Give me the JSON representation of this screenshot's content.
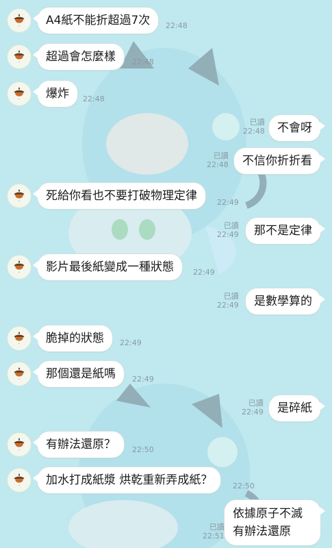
{
  "messages": [
    {
      "side": "left",
      "text": "A4紙不能折超過7次",
      "time": "22:48"
    },
    {
      "side": "left",
      "text": "超過會怎麼樣",
      "time": "22:48"
    },
    {
      "side": "left",
      "text": "爆炸",
      "time": "22:48"
    },
    {
      "side": "right",
      "text": "不會呀",
      "time": "22:48",
      "read": "已讀"
    },
    {
      "side": "right",
      "text": "不信你折折看",
      "time": "22:48",
      "read": "已讀"
    },
    {
      "side": "left",
      "text": "死給你看也不要打破物理定律",
      "time": "22:49"
    },
    {
      "side": "right",
      "text": "那不是定律",
      "time": "22:49",
      "read": "已讀"
    },
    {
      "side": "left",
      "text": "影片最後紙變成一種狀態",
      "time": "22:49"
    },
    {
      "side": "right",
      "text": "是數學算的",
      "time": "22:49",
      "read": "已讀"
    },
    {
      "side": "left",
      "text": "脆掉的狀態",
      "time": "22:49"
    },
    {
      "side": "left",
      "text": "那個還是紙嗎",
      "time": "22:49"
    },
    {
      "side": "right",
      "text": "是碎紙",
      "time": "22:49",
      "read": "已讀"
    },
    {
      "side": "left",
      "text": "有辦法還原？",
      "time": "22:50"
    },
    {
      "side": "left",
      "text": "加水打成紙漿 烘乾重新弄成紙？",
      "time": "22:50"
    },
    {
      "side": "right",
      "text": "依據原子不滅 有辦法還原",
      "time": "22:51",
      "read": "已讀"
    }
  ],
  "avatar_icon": "acorn-icon",
  "colors": {
    "background": "#bfe8ef",
    "bubble": "#ffffff",
    "meta": "#8a9aa0",
    "acorn_cap": "#6b3d1f",
    "acorn_body": "#c86b2a"
  }
}
